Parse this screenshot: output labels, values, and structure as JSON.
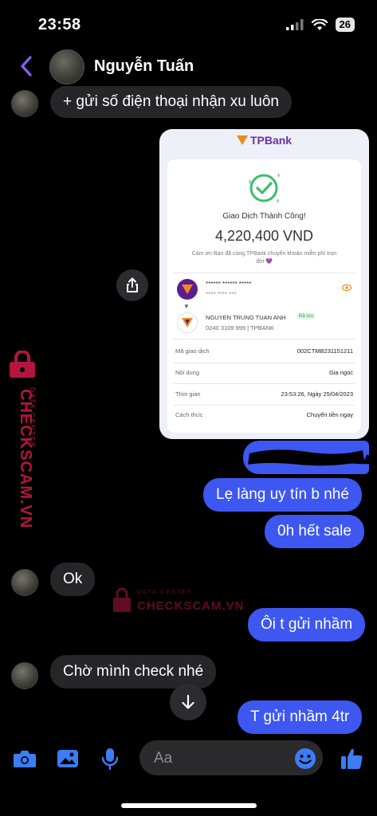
{
  "status_bar": {
    "time": "23:58",
    "battery": "26"
  },
  "header": {
    "contact_name": "Nguyễn Tuấn"
  },
  "messages": {
    "incoming_1": "+ gửi số điện thoại nhận xu luôn",
    "outgoing_1": "Lẹ làng uy tín b nhé",
    "outgoing_2": "0h hết sale",
    "incoming_2": "Ok",
    "outgoing_3": "Ôi t gửi nhầm",
    "incoming_3": "Chờ mình check nhé",
    "outgoing_4": "T gửi nhầm 4tr"
  },
  "receipt": {
    "bank_name": "TPBank",
    "status_title": "Giao Dịch Thành Công!",
    "amount": "4,220,400 VND",
    "thank_note": "Cám ơn Bạn đã cùng TPBank chuyển khoản miễn phí trọn đời 💜",
    "sender_masked": "****** ****** *****",
    "sender_masked_2": "**** **** ***",
    "receiver_name": "NGUYEN TRUNG TUAN ANH",
    "saved_badge": "Đã lưu",
    "receiver_account": "0240 3109 999 | TPBANK",
    "rows": [
      {
        "label": "Mã giao dịch",
        "value": "002CTMB231151211"
      },
      {
        "label": "Nội dung",
        "value": "Gia ngoc"
      },
      {
        "label": "Thời gian",
        "value": "23:53:26, Ngày 25/04/2023"
      },
      {
        "label": "Cách thức",
        "value": "Chuyển tiền ngay"
      }
    ]
  },
  "watermark": {
    "side_main": "CHECKSCAM.VN",
    "side_sub": "DATA CENTER",
    "mid_sub": "DATA CENTER",
    "mid_main": "CHECKSCAM.VN"
  },
  "composer": {
    "placeholder": "Aa"
  },
  "colors": {
    "outgoing_bubble": "#3d57f0",
    "incoming_bubble": "#262628",
    "accent_purple": "#8b5cf6",
    "watermark_red": "#b3163d",
    "composer_icon_blue": "#3d7cf5"
  },
  "icons": [
    "back-chevron",
    "share",
    "chevron-down",
    "camera",
    "image",
    "microphone",
    "emoji",
    "thumbs-up"
  ]
}
